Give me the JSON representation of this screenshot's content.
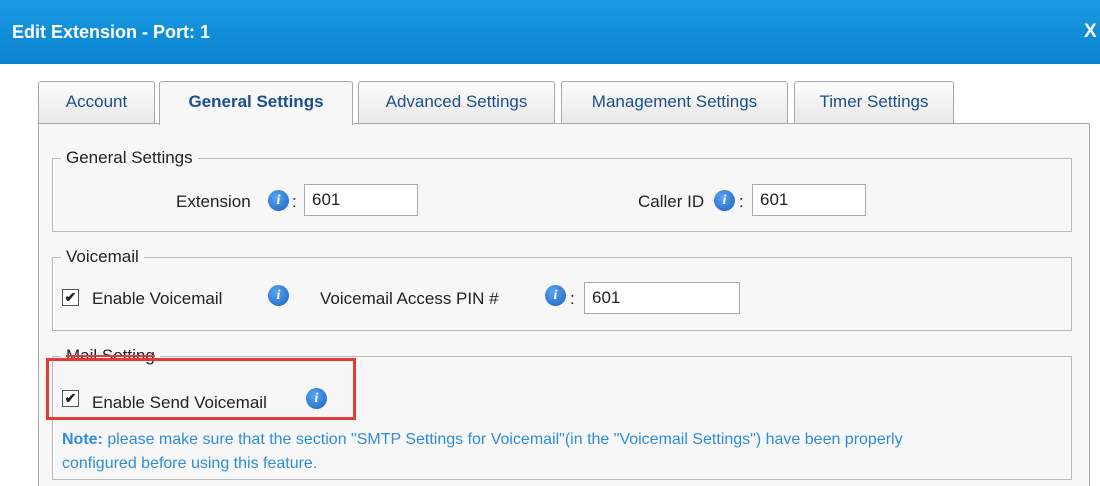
{
  "window": {
    "title": "Edit Extension - Port: 1",
    "close_label": "X"
  },
  "tabs": [
    {
      "label": "Account"
    },
    {
      "label": "General Settings"
    },
    {
      "label": "Advanced Settings"
    },
    {
      "label": "Management Settings"
    },
    {
      "label": "Timer Settings"
    }
  ],
  "general": {
    "legend": "General Settings",
    "extension_label": "Extension",
    "extension_value": "601",
    "callerid_label": "Caller ID",
    "callerid_value": "601"
  },
  "voicemail": {
    "legend": "Voicemail",
    "enable_label": "Enable Voicemail",
    "pin_label": "Voicemail Access PIN #",
    "pin_value": "601"
  },
  "mail": {
    "legend": "Mail Setting",
    "enable_send_label": "Enable Send Voicemail",
    "note_prefix": "Note:",
    "note_text": " please make sure that the section \"SMTP Settings for Voicemail\"(in the \"Voicemail Settings\") have been properly configured before using this feature."
  },
  "common": {
    "colon": ":",
    "info_glyph": "i",
    "check_glyph": "✔"
  },
  "colors": {
    "title_bar": "#0a8fdc",
    "note_text": "#2f8dd8",
    "highlight": "#e53935"
  }
}
